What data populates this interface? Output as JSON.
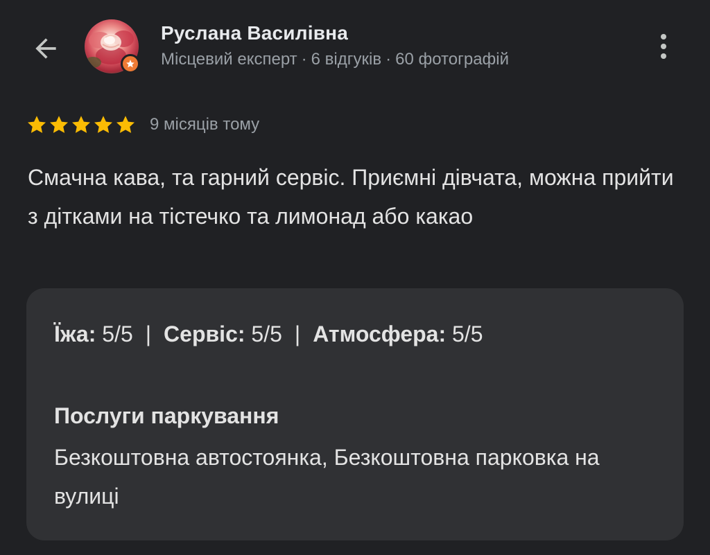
{
  "header": {
    "back_icon": "arrow-back-icon",
    "avatar_icon": "rose-photo",
    "badge_icon": "local-guide-star-icon",
    "badge_color": "#ee7b35",
    "user_name": "Руслана Василівна",
    "meta": {
      "role": "Місцевий експерт",
      "reviews": "6 відгуків",
      "photos": "60 фотографій",
      "separator": "·"
    },
    "more_icon": "more-vert-icon"
  },
  "review": {
    "stars": 5,
    "max_stars": 5,
    "star_color": "#fbbc04",
    "date": "9 місяців тому",
    "text": "Смачна кава, та гарний сервіс. Приємні дівчата, можна прийти з дітками на тістечко та лимонад або какао"
  },
  "attributes": {
    "scores": [
      {
        "label": "Їжа:",
        "value": "5/5"
      },
      {
        "label": "Сервіс:",
        "value": "5/5"
      },
      {
        "label": "Атмосфера:",
        "value": "5/5"
      }
    ],
    "divider": "|",
    "parking": {
      "title": "Послуги паркування",
      "value": "Безкоштовна автостоянка, Безкоштовна парковка на вулиці"
    }
  },
  "colors": {
    "background": "#202124",
    "card": "#303134",
    "text_primary": "#e3e3e3",
    "text_secondary": "#9aa0a6"
  }
}
